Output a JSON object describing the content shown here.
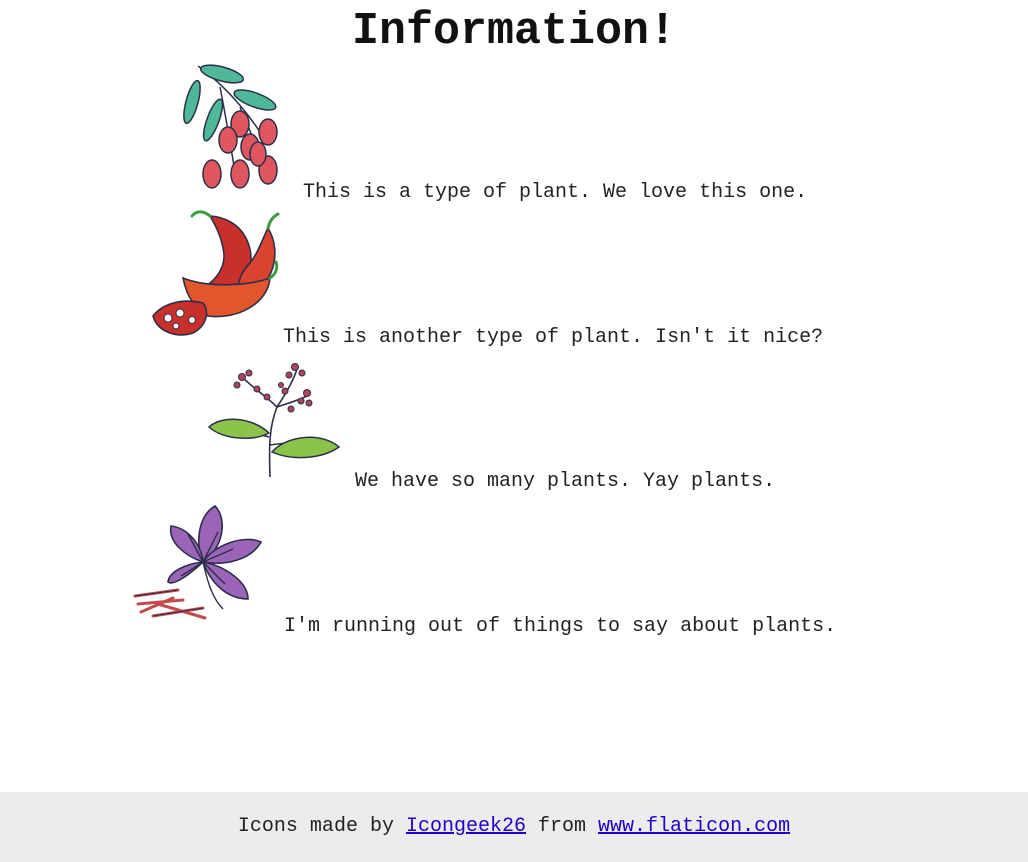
{
  "header": {
    "title": "Information!"
  },
  "plants": [
    {
      "icon": "goji-berry-icon",
      "caption": "This is a type of plant. We love this one."
    },
    {
      "icon": "chili-pepper-icon",
      "caption": "This is another type of plant. Isn't it nice?"
    },
    {
      "icon": "flowering-sprig-icon",
      "caption": "We have so many plants. Yay plants."
    },
    {
      "icon": "saffron-crocus-icon",
      "caption": "I'm running out of things to say about plants."
    }
  ],
  "footer": {
    "prefix": "Icons made by",
    "author_link": "Icongeek26",
    "middle": "from",
    "site_link": "www.flaticon.com"
  },
  "colors": {
    "link": "#2200cc",
    "footer_bg": "#ececec",
    "leaf_teal": "#4fb89b",
    "berry_red": "#e0565f",
    "pepper_red": "#c9302c",
    "leaf_green": "#8cc34a",
    "flower_purple": "#9b64b8"
  }
}
